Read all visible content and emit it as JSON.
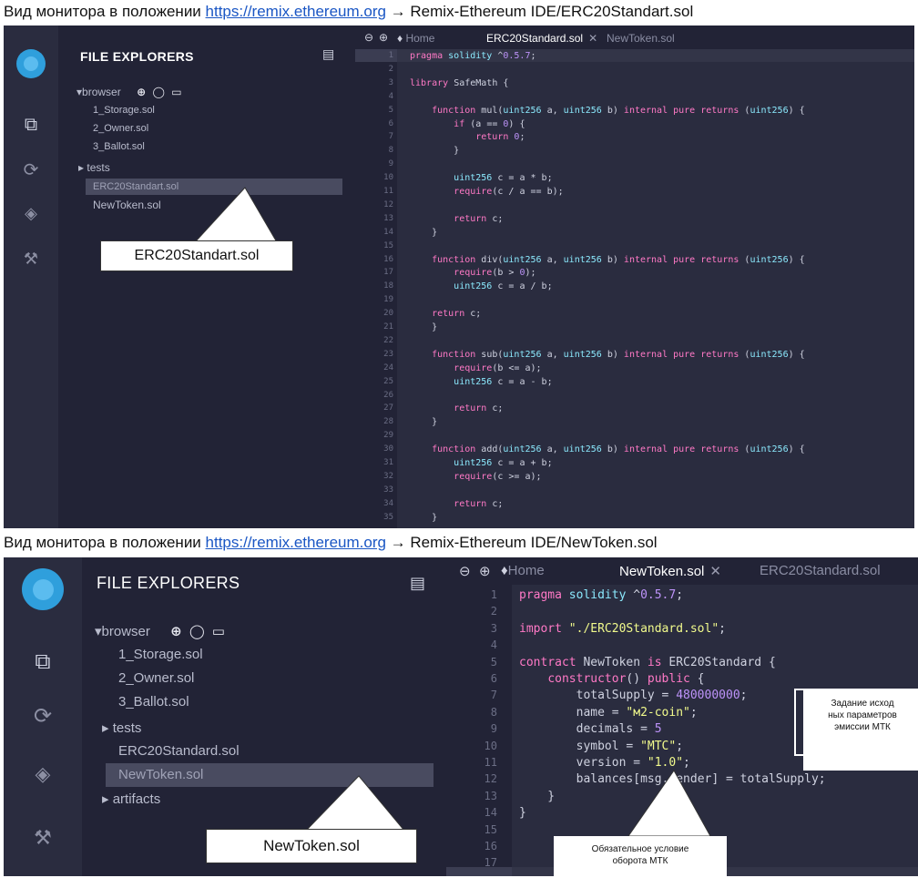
{
  "captions": {
    "top": {
      "prefix": "Вид монитора в положении ",
      "link": "https://remix.ethereum.org",
      "suffix": " → Remix-Ethereum IDE/ERC20Standart.sol"
    },
    "bottom": {
      "prefix": "Вид монитора в положении ",
      "link": "https://remix.ethereum.org",
      "suffix": " → Remix-Ethereum IDE/NewToken.sol"
    }
  },
  "shot1": {
    "explorer_title": "FILE EXPLORERS",
    "browser_label": "browser",
    "files": [
      "1_Storage.sol",
      "2_Owner.sol",
      "3_Ballot.sol"
    ],
    "folder_tests": "tests",
    "file_erc20": "ERC20Standart.sol",
    "file_newtoken": "NewToken.sol",
    "tabs": {
      "home": "Home",
      "active": "ERC20Standard.sol",
      "other": "NewToken.sol"
    },
    "callout": "ERC20Standart.sol",
    "code": [
      "pragma solidity ^0.5.7;",
      "",
      "library SafeMath {",
      "",
      "    function mul(uint256 a, uint256 b) internal pure returns (uint256) {",
      "        if (a == 0) {",
      "            return 0;",
      "        }",
      "",
      "        uint256 c = a * b;",
      "        require(c / a == b);",
      "",
      "        return c;",
      "    }",
      "",
      "    function div(uint256 a, uint256 b) internal pure returns (uint256) {",
      "        require(b > 0);",
      "        uint256 c = a / b;",
      "",
      "    return c;",
      "    }",
      "",
      "    function sub(uint256 a, uint256 b) internal pure returns (uint256) {",
      "        require(b <= a);",
      "        uint256 c = a - b;",
      "",
      "        return c;",
      "    }",
      "",
      "    function add(uint256 a, uint256 b) internal pure returns (uint256) {",
      "        uint256 c = a + b;",
      "        require(c >= a);",
      "",
      "        return c;",
      "    }"
    ],
    "line_numbers": [
      "1",
      "2",
      "3",
      "4",
      "5",
      "6",
      "7",
      "8",
      "9",
      "10",
      "11",
      "12",
      "13",
      "14",
      "15",
      "16",
      "17",
      "18",
      "19",
      "20",
      "21",
      "22",
      "23",
      "24",
      "25",
      "26",
      "27",
      "28",
      "29",
      "30",
      "31",
      "32",
      "33",
      "34",
      "35"
    ]
  },
  "shot2": {
    "explorer_title": "FILE EXPLORERS",
    "browser_label": "browser",
    "files": [
      "1_Storage.sol",
      "2_Owner.sol",
      "3_Ballot.sol"
    ],
    "folder_tests": "tests",
    "file_erc20": "ERC20Standard.sol",
    "file_newtoken": "NewToken.sol",
    "folder_artifacts": "artifacts",
    "tabs": {
      "home": "Home",
      "active": "NewToken.sol",
      "other": "ERC20Standard.sol"
    },
    "callout": "NewToken.sol",
    "annot_params": [
      "Задание исход",
      "ных параметров",
      "эмиссии МТК"
    ],
    "annot_condition": [
      "Обязательное условие",
      "оборота МТК"
    ],
    "code": [
      "pragma solidity ^0.5.7;",
      "",
      "import \"./ERC20Standard.sol\";",
      "",
      "contract NewToken is ERC20Standard {",
      "    constructor() public {",
      "        totalSupply = 480000000;",
      "        name = \"м2-coin\";",
      "        decimals = 5",
      "        symbol = \"МТС\";",
      "        version = \"1.0\";",
      "        balances[msg.sender] = totalSupply;",
      "    }",
      "}",
      "",
      "",
      ""
    ],
    "line_numbers": [
      "1",
      "2",
      "3",
      "4",
      "5",
      "6",
      "7",
      "8",
      "9",
      "10",
      "11",
      "12",
      "13",
      "14",
      "15",
      "16",
      "17"
    ]
  }
}
